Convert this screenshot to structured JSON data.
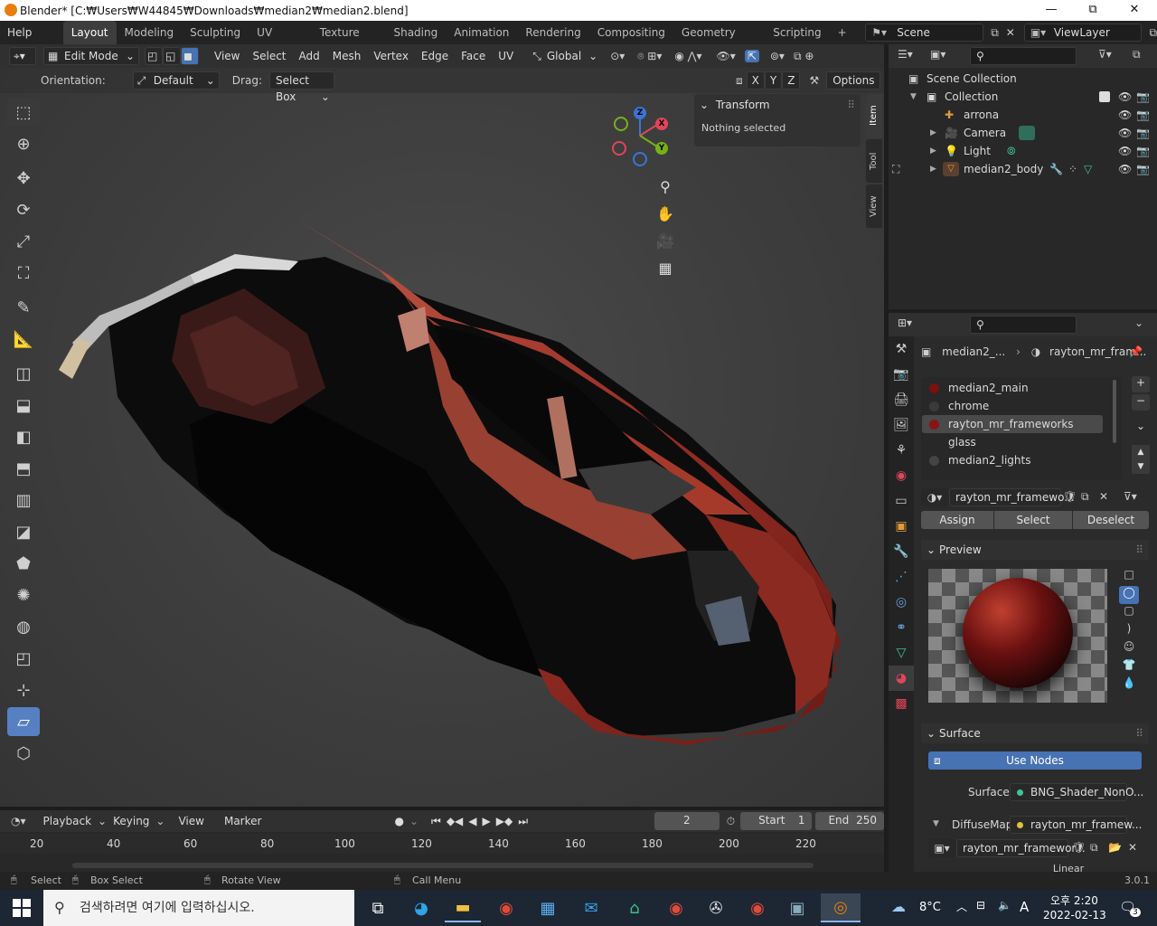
{
  "window": {
    "title": "Blender* [C:₩Users₩W44845₩Downloads₩median2₩median2.blend]",
    "minimize": "—",
    "maximize": "⧉",
    "close": "✕"
  },
  "topbar": {
    "menus": [
      "Help"
    ],
    "workspaces": [
      "Layout",
      "Modeling",
      "Sculpting",
      "UV Editing",
      "Texture Paint",
      "Shading",
      "Animation",
      "Rendering",
      "Compositing",
      "Geometry Nodes",
      "Scripting"
    ],
    "active_workspace": "Layout",
    "add_workspace": "+",
    "scene": "Scene",
    "view_layer": "ViewLayer"
  },
  "viewport_header": {
    "mode": "Edit Mode",
    "menus": [
      "View",
      "Select",
      "Add",
      "Mesh",
      "Vertex",
      "Edge",
      "Face",
      "UV"
    ],
    "transform_orientation": "Global",
    "orientation_label": "Orientation:",
    "orientation_value": "Default",
    "drag_label": "Drag:",
    "drag_value": "Select Box",
    "axes": [
      "X",
      "Y",
      "Z"
    ],
    "options": "Options"
  },
  "npanel": {
    "section": "Transform",
    "message": "Nothing selected",
    "tabs": [
      "Item",
      "Tool",
      "View"
    ]
  },
  "gizmo": {
    "x": "X",
    "y": "Y",
    "z": "Z"
  },
  "outliner": {
    "root": "Scene Collection",
    "collection": "Collection",
    "items": [
      {
        "name": "arrona",
        "icon": "armature-icon"
      },
      {
        "name": "Camera",
        "icon": "camera-icon"
      },
      {
        "name": "Light",
        "icon": "light-icon"
      },
      {
        "name": "median2_body",
        "icon": "mesh-icon"
      }
    ]
  },
  "properties": {
    "breadcrumb_object": "median2_...",
    "breadcrumb_material": "rayton_mr_fram...",
    "slots": [
      {
        "name": "median2_main",
        "color": "#7a1010"
      },
      {
        "name": "chrome",
        "color": "#3a3a3a"
      },
      {
        "name": "rayton_mr_frameworks",
        "color": "#8a1414"
      },
      {
        "name": "glass",
        "color": ""
      },
      {
        "name": "median2_lights",
        "color": "#444444"
      }
    ],
    "active_slot": 2,
    "material_name": "rayton_mr_framewo...",
    "assign": "Assign",
    "select": "Select",
    "deselect": "Deselect",
    "preview_label": "Preview",
    "surface_section": "Surface",
    "use_nodes": "Use Nodes",
    "surface_label": "Surface",
    "surface_value": "BNG_Shader_NonO...",
    "diffuse_label": "DiffuseMap",
    "diffuse_value": "rayton_mr_framew...",
    "image_name": "rayton_mr_framewor...",
    "interpolation": "Linear"
  },
  "timeline": {
    "menus": [
      "Playback",
      "Keying",
      "View",
      "Marker"
    ],
    "current_frame": "2",
    "start_label": "Start",
    "start_value": "1",
    "end_label": "End",
    "end_value": "250",
    "ruler_ticks": [
      "20",
      "40",
      "60",
      "80",
      "100",
      "120",
      "140",
      "160",
      "180",
      "200",
      "220"
    ]
  },
  "statusbar": {
    "select": "Select",
    "box_select": "Box Select",
    "rotate_view": "Rotate View",
    "call_menu": "Call Menu",
    "version": "3.0.1"
  },
  "taskbar": {
    "search_placeholder": "검색하려면 여기에 입력하십시오.",
    "temperature": "8°C",
    "ime": "A",
    "time": "오후 2:20",
    "date": "2022-02-13",
    "notifications": "3"
  },
  "colors": {
    "accent": "#4772b3",
    "active_tool": "#5680c2",
    "car_body": "#a23a2c"
  }
}
